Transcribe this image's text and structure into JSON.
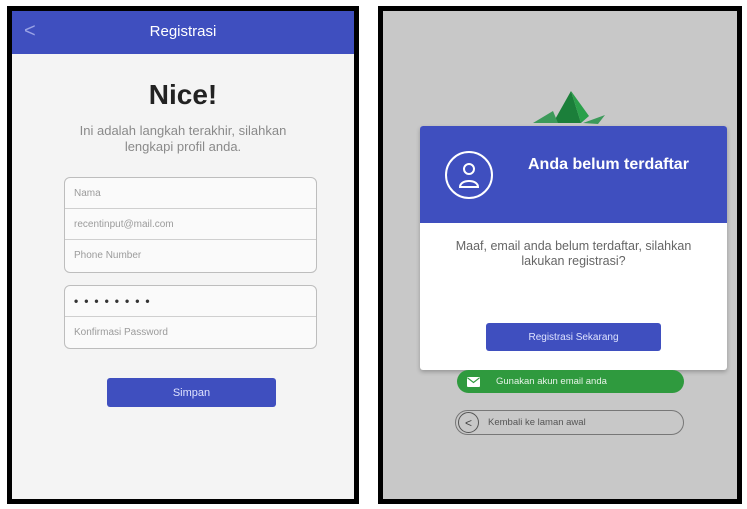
{
  "left_screen": {
    "header": {
      "title": "Registrasi",
      "back_glyph": "<"
    },
    "heading": "Nice!",
    "subtitle": "Ini adalah langkah terakhir, silahkan lengkapi profil anda.",
    "fields": {
      "name_placeholder": "Nama",
      "email_placeholder": "recentinput@mail.com",
      "phone_placeholder": "Phone Number",
      "password_value": "••••••••",
      "confirm_password_placeholder": "Konfirmasi Password"
    },
    "save_label": "Simpan"
  },
  "right_screen": {
    "dialog": {
      "title": "Anda belum terdaftar",
      "message": "Maaf, email anda belum terdaftar, silahkan lakukan registrasi?",
      "register_label": "Registrasi Sekarang",
      "icon": "user-icon"
    },
    "email_login_label": "Gunakan akun email anda",
    "back_home_label": "Kembali ke laman awal",
    "back_glyph": "<"
  },
  "colors": {
    "primary": "#3f4fbf",
    "green": "#2f9a3e",
    "background_left": "#f4f4f4",
    "background_right": "#c8c8c8"
  }
}
